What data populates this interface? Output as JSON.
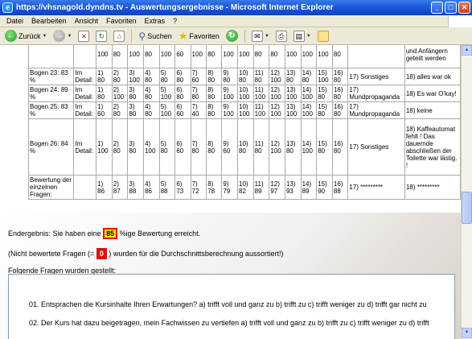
{
  "window": {
    "title": "https://vhsnagold.dyndns.tv - Auswertungsergebnisse - Microsoft Internet Explorer",
    "buttons": {
      "minimize": "_",
      "maximize": "□",
      "close": "✕"
    }
  },
  "menu": [
    "Datei",
    "Bearbeiten",
    "Ansicht",
    "Favoriten",
    "Extras",
    "?"
  ],
  "toolbar": {
    "back": "Zurück",
    "search": "Suchen",
    "favorites": "Favoriten"
  },
  "rows": [
    {
      "name": "",
      "im": "",
      "cells": [
        "100",
        "80",
        "100",
        "80",
        "100",
        "60",
        "100",
        "80",
        "100",
        "100",
        "80",
        "80",
        "100",
        "100",
        "100",
        "80"
      ],
      "s17": "",
      "s18": "und Anfängern geteilt werden"
    },
    {
      "name": "Bogen 23: 83 %",
      "im": "Im Detail:",
      "cells": [
        "1) 80",
        "2) 80",
        "3) 100",
        "4) 80",
        "5) 80",
        "6) 80",
        "7) 60",
        "8) 80",
        "9) 80",
        "10) 80",
        "11) 80",
        "12) 100",
        "13) 80",
        "14) 80",
        "15) 100",
        "16) 80"
      ],
      "s17": "17) Sonstiges",
      "s18": "18) alles war ok"
    },
    {
      "name": "Bogen 24: 89 %",
      "im": "Im Detail:",
      "cells": [
        "1) 80",
        "2) 100",
        "3) 80",
        "4) 80",
        "5) 100",
        "6) 80",
        "7) 80",
        "8) 80",
        "9) 100",
        "10) 100",
        "11) 100",
        "12) 100",
        "13) 100",
        "14) 100",
        "15) 80",
        "16) 80"
      ],
      "s17": "17) Mundpropaganda",
      "s18": "18) Es war O'kay!"
    },
    {
      "name": "Bogen 25: 83 %",
      "im": "Im Detail:",
      "cells": [
        "1) 60",
        "2) 80",
        "3) 80",
        "4) 80",
        "5) 100",
        "6) 60",
        "7) 40",
        "8) 80",
        "9) 100",
        "10) 100",
        "11) 100",
        "12) 100",
        "13) 100",
        "14) 100",
        "15) 80",
        "16) 80"
      ],
      "s17": "17) Mundpropaganda",
      "s18": "18) keine"
    },
    {
      "name": "Bogen 26: 84 %",
      "im": "Im Detail:",
      "cells": [
        "1) 100",
        "2) 80",
        "3) 80",
        "4) 100",
        "5) 80",
        "6) 60",
        "7) 80",
        "8) 80",
        "9) 60",
        "10) 80",
        "11) 80",
        "12) 100",
        "13) 80",
        "14) 100",
        "15) 80",
        "16) 80"
      ],
      "s17": "17) Sonstiges",
      "s18": "18) Kaffeautomat fehlt ! Das dauernde abschließen der Toilette war lästig. !"
    },
    {
      "name": "Bewertung der einzelnen Fragen:",
      "im": "",
      "cells": [
        "1) 86",
        "2) 87",
        "3) 88",
        "4) 86",
        "5) 88",
        "6) 73",
        "7) 72",
        "8) 78",
        "9) 79",
        "10) 82",
        "11) 89",
        "12) 97",
        "13) 93",
        "14) 89",
        "15) 90",
        "16) 88"
      ],
      "s17": "17) *********",
      "s18": "18) *********"
    }
  ],
  "summary": {
    "end_prefix": "Endergebnis: Sie haben eine",
    "end_value": "85",
    "end_suffix": "%ige Bewertung erreicht.",
    "unrated_prefix": "(Nicht bewertete Fragen (=",
    "unrated_value": "0",
    "unrated_suffix": ") wurden für die Durchschnittsberechnung aussortiert!)",
    "questions_heading": "Folgende Fragen wurden gestellt:"
  },
  "questions": [
    "01. Entsprachen die Kursinhalte Ihren Erwartungen? a) trifft voll und ganz zu b) trifft zu c) trifft weniger zu d) trifft gar nicht zu",
    "02. Der Kurs hat dazu beigetragen, mein Fachwissen zu vertiefen a) trifft voll und ganz zu b) trifft zu c) trifft weniger zu d) trifft"
  ]
}
